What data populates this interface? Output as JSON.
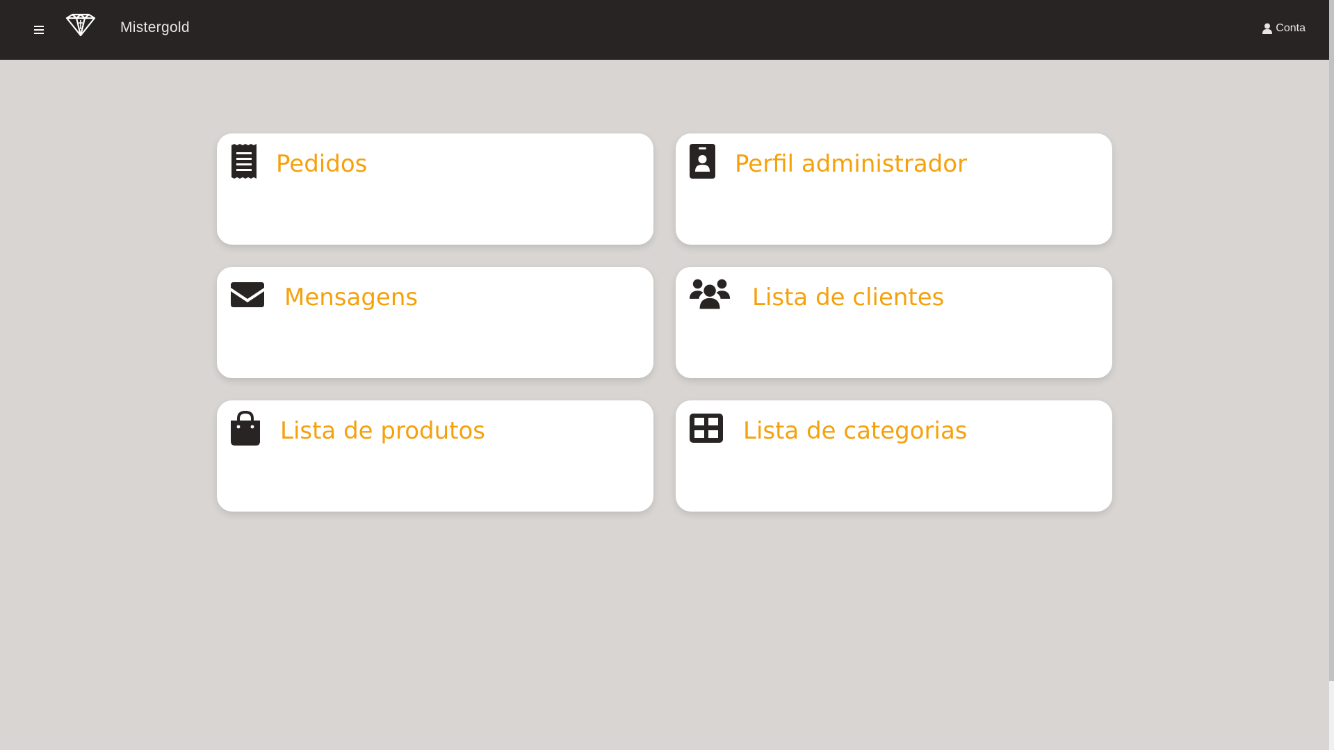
{
  "navbar": {
    "brand": "Mistergold",
    "account_label": "Conta",
    "menu_icon": "hamburger-menu-icon",
    "logo_icon": "diamond-logo-icon",
    "account_icon": "user-icon"
  },
  "cards": [
    {
      "label": "Pedidos",
      "icon": "receipt-icon"
    },
    {
      "label": "Perfil administrador",
      "icon": "id-badge-icon"
    },
    {
      "label": "Mensagens",
      "icon": "envelope-icon"
    },
    {
      "label": "Lista de clientes",
      "icon": "users-icon"
    },
    {
      "label": "Lista de produtos",
      "icon": "shopping-bag-icon"
    },
    {
      "label": "Lista de categorias",
      "icon": "grid-icon"
    }
  ],
  "colors": {
    "navbar_bg": "#282424",
    "page_bg": "#d8d5d2",
    "card_bg": "#ffffff",
    "accent": "#f5a10c",
    "icon": "#282424"
  }
}
